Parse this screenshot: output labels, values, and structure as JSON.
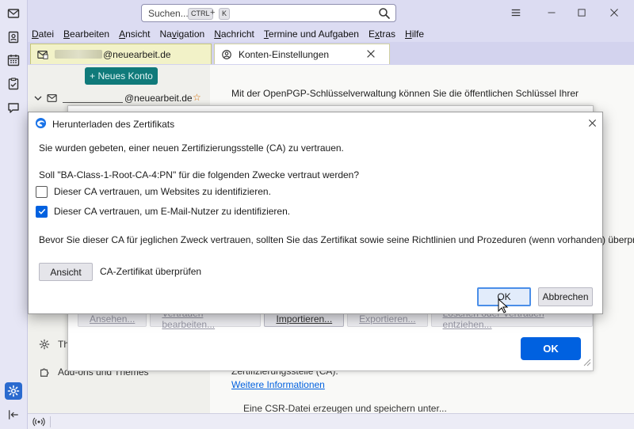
{
  "titlebar": {
    "search_placeholder": "Suchen...",
    "shortcut_key1": "CTRL",
    "shortcut_plus": "+",
    "shortcut_key2": "K"
  },
  "menubar": {
    "items": [
      {
        "u": "D",
        "rest": "atei"
      },
      {
        "u": "B",
        "rest": "earbeiten"
      },
      {
        "u": "A",
        "rest": "nsicht"
      },
      {
        "pre": "Na",
        "u": "v",
        "rest": "igation"
      },
      {
        "u": "N",
        "rest": "achricht"
      },
      {
        "u": "T",
        "rest": "ermine und Aufgaben"
      },
      {
        "pre": "E",
        "u": "x",
        "rest": "tras"
      },
      {
        "u": "H",
        "rest": "ilfe"
      }
    ]
  },
  "tabs": {
    "tab1_label": "@neuearbeit.de",
    "tab2_label": "Konten-Einstellungen"
  },
  "left_pane": {
    "new_account": "+ Neues Konto",
    "account_label": "@neuearbeit.de",
    "themes_label": "Th",
    "addons_label": "Add-ons und Themes"
  },
  "right_pane": {
    "openpgp_text": "Mit der OpenPGP-Schlüsselverwaltung können Sie die öffentlichen Schlüssel Ihrer",
    "bg_buttons": [
      "Ansehen...",
      "Vertrauen bearbeiten...",
      "Importieren...",
      "Exportieren...",
      "Löschen oder Vertrauen entziehen..."
    ],
    "bg_ok": "OK",
    "zert_text": "Zertifizierungsstelle (CA).",
    "more_info": "Weitere Informationen",
    "csr_text": "Eine CSR-Datei erzeugen und speichern unter..."
  },
  "dialog": {
    "title": "Herunterladen des Zertifikats",
    "intro": "Sie wurden gebeten, einer neuen Zertifizierungsstelle (CA) zu vertrauen.",
    "question": "Soll \"BA-Class-1-Root-CA-4:PN\" für die folgenden Zwecke vertraut werden?",
    "cb_websites": "Dieser CA vertrauen, um Websites zu identifizieren.",
    "cb_websites_checked": false,
    "cb_email": "Dieser CA vertrauen, um E-Mail-Nutzer zu identifizieren.",
    "cb_email_checked": true,
    "warning": "Bevor Sie dieser CA für jeglichen Zweck vertrauen, sollten Sie das Zertifikat sowie seine Richtlinien und Prozeduren (wenn vorhanden) überprüfen.",
    "view_button": "Ansicht",
    "view_label": "CA-Zertifikat überprüfen",
    "ok_button": "OK",
    "cancel_button": "Abbrechen"
  },
  "colors": {
    "accent": "#0061e0",
    "new_account_bg": "#107a7a",
    "link": "#0060df"
  }
}
